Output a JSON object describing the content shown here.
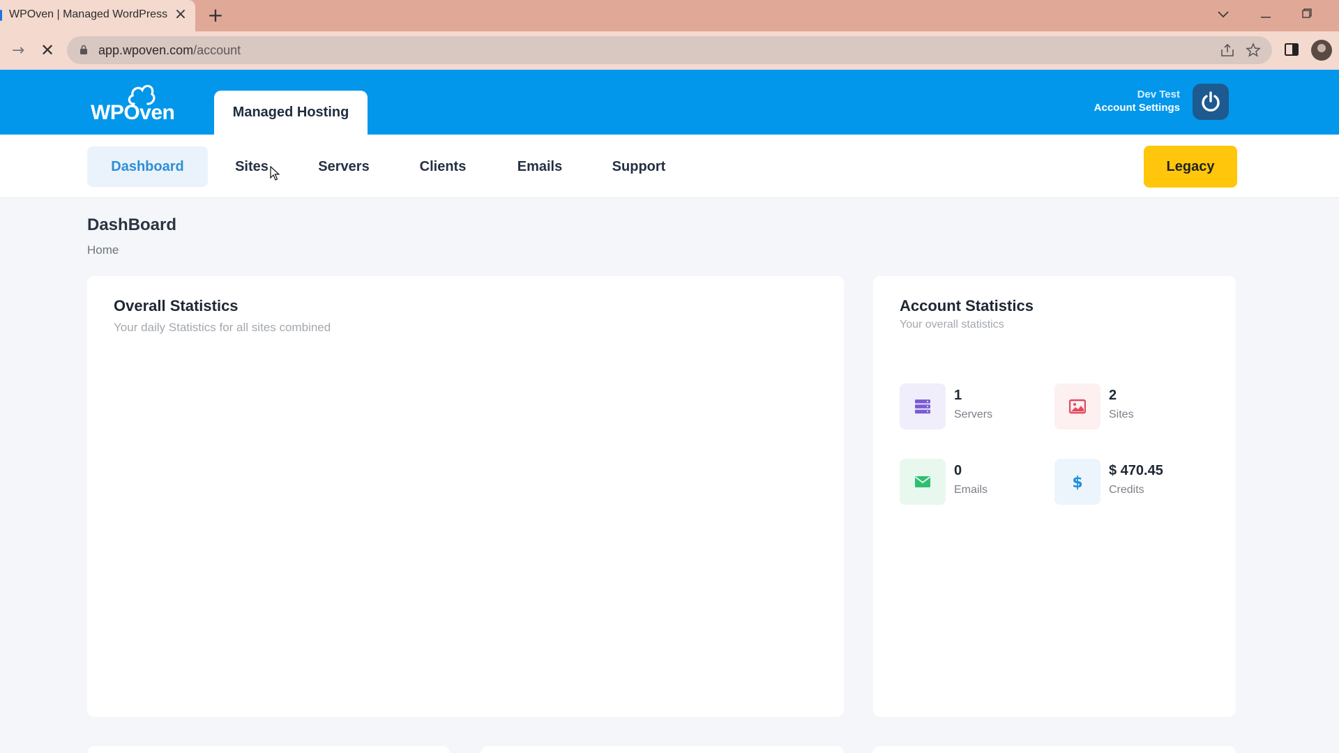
{
  "browser": {
    "tab_title": "WPOven | Managed WordPress H",
    "url_host": "app.wpoven.com",
    "url_path": "/account"
  },
  "header": {
    "logo_text": "WPOven",
    "main_tab": "Managed Hosting",
    "user_name": "Dev Test",
    "account_settings": "Account Settings"
  },
  "nav": {
    "items": [
      {
        "label": "Dashboard",
        "active": true
      },
      {
        "label": "Sites"
      },
      {
        "label": "Servers"
      },
      {
        "label": "Clients"
      },
      {
        "label": "Emails"
      },
      {
        "label": "Support"
      }
    ],
    "legacy_label": "Legacy"
  },
  "page": {
    "title": "DashBoard",
    "breadcrumb": "Home"
  },
  "overall": {
    "title": "Overall Statistics",
    "subtitle": "Your daily Statistics for all sites combined"
  },
  "account": {
    "title": "Account Statistics",
    "subtitle": "Your overall statistics",
    "stats": [
      {
        "value": "1",
        "label": "Servers",
        "icon": "server-icon",
        "color": "#7b5cd6",
        "bg": "#f1eefb"
      },
      {
        "value": "2",
        "label": "Sites",
        "icon": "image-icon",
        "color": "#e5485d",
        "bg": "#fcf0f1"
      },
      {
        "value": "0",
        "label": "Emails",
        "icon": "envelope-icon",
        "color": "#2fbf71",
        "bg": "#e8f8ef"
      },
      {
        "value": "$ 470.45",
        "label": "Credits",
        "icon": "dollar-icon",
        "color": "#1f8fdb",
        "bg": "#edf5fc"
      }
    ]
  },
  "colors": {
    "header_blue": "#0397eb",
    "legacy_yellow": "#ffc60b",
    "active_nav_bg": "#eaf3fb",
    "active_nav_text": "#2d8ed6"
  }
}
